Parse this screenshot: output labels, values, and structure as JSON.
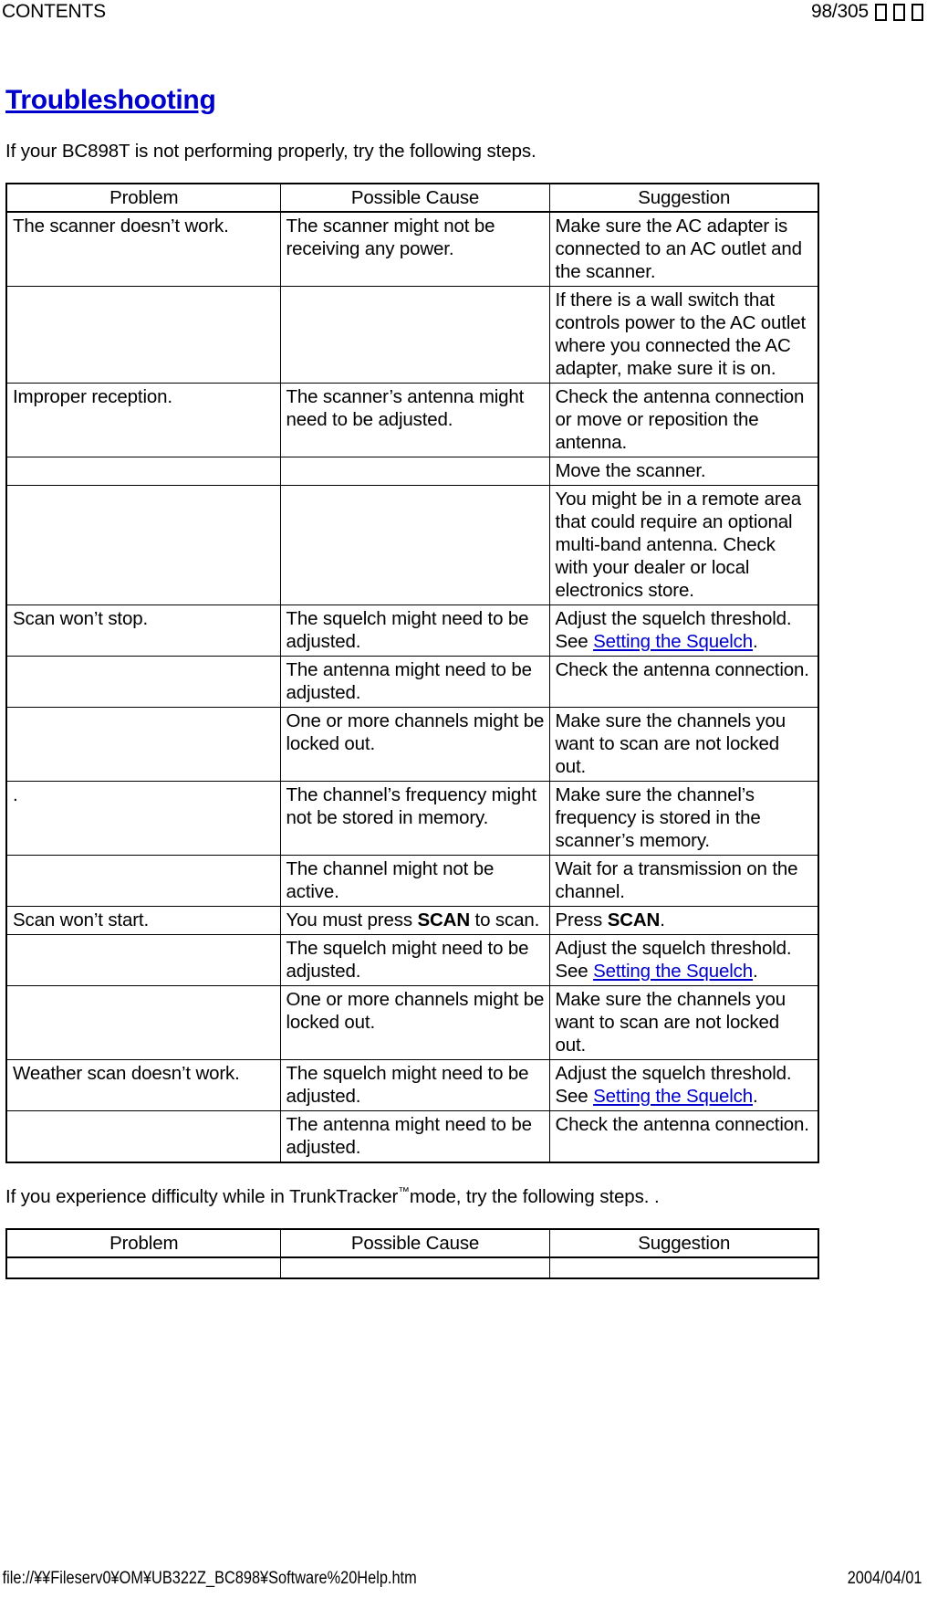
{
  "browser_header": {
    "left_label": "CONTENTS",
    "page_indicator": "98/305",
    "missing_glyphs": [
      "tofu-box",
      "tofu-box",
      "tofu-box"
    ]
  },
  "browser_footer": {
    "url": "file://¥¥Fileserv0¥OM¥UB322Z_BC898¥Software%20Help.htm",
    "date": "2004/04/01"
  },
  "document": {
    "title": "Troubleshooting",
    "intro": "If your BC898T is not performing properly, try the following steps.",
    "intro2_prefix": "If you experience difficulty while in TrunkTracker",
    "intro2_tm": "™",
    "intro2_suffix": "mode, try the following steps. ."
  },
  "table1": {
    "headers": [
      "Problem",
      "Possible Cause",
      "Suggestion"
    ],
    "rows": [
      {
        "problem": "The scanner doesn’t work.",
        "cause": "The scanner might not be receiving any power.",
        "suggestion": "Make sure the AC adapter is connected to an AC outlet and the scanner."
      },
      {
        "problem": "",
        "cause": "",
        "suggestion": "If there is a wall switch that controls power to the AC outlet where you connected the AC adapter, make sure it is on."
      },
      {
        "problem": "Improper reception.",
        "cause": "The scanner’s antenna might need to be adjusted.",
        "suggestion": "Check the antenna connection or move or reposition the antenna."
      },
      {
        "problem": "",
        "cause": "",
        "suggestion": "Move the scanner."
      },
      {
        "problem": "",
        "cause": "",
        "suggestion": "You might be in a remote area that could require an optional multi-band antenna. Check with your dealer or local electronics store."
      },
      {
        "problem": "Scan won’t stop.",
        "cause": "The squelch might need to be adjusted.",
        "suggestion_pre": "Adjust the squelch threshold.  See ",
        "suggestion_link": "Setting the Squelch",
        "suggestion_post": "."
      },
      {
        "problem": "",
        "cause": "The antenna might need to be adjusted.",
        "suggestion": "Check the antenna connection."
      },
      {
        "problem": "",
        "cause": "One or more channels might be locked out.",
        "suggestion": "Make sure the channels you want to scan are not locked out."
      },
      {
        "problem": ".",
        "cause": "The channel’s frequency might not be stored in memory.",
        "suggestion": "Make sure the channel’s frequency is stored in the scanner’s memory."
      },
      {
        "problem": "",
        "cause": "The channel might not be active.",
        "suggestion": "Wait for a transmission on the channel."
      },
      {
        "problem": "Scan won’t start.",
        "cause_pre": "You must press ",
        "cause_kbd": "SCAN",
        "cause_post": " to scan.",
        "suggestion_pre": "Press ",
        "suggestion_kbd": "SCAN",
        "suggestion_post": "."
      },
      {
        "problem": "",
        "cause": "The squelch might need to be adjusted.",
        "suggestion_pre": "Adjust the squelch threshold.  See ",
        "suggestion_link": "Setting the Squelch",
        "suggestion_post": "."
      },
      {
        "problem": "",
        "cause": "One or more channels might be locked out.",
        "suggestion": "Make sure the channels you want to scan are not locked out."
      },
      {
        "problem": "Weather scan doesn’t work.",
        "cause": "The squelch might need to be adjusted.",
        "suggestion_pre": "Adjust the squelch threshold.  See ",
        "suggestion_link": "Setting the Squelch",
        "suggestion_post": "."
      },
      {
        "problem": "",
        "cause": "The antenna might need to be adjusted.",
        "suggestion": "Check the antenna connection."
      }
    ]
  },
  "table2": {
    "headers": [
      "Problem",
      "Possible Cause",
      "Suggestion"
    ],
    "rows": [
      {
        "problem": "",
        "cause": "",
        "suggestion": ""
      }
    ]
  }
}
